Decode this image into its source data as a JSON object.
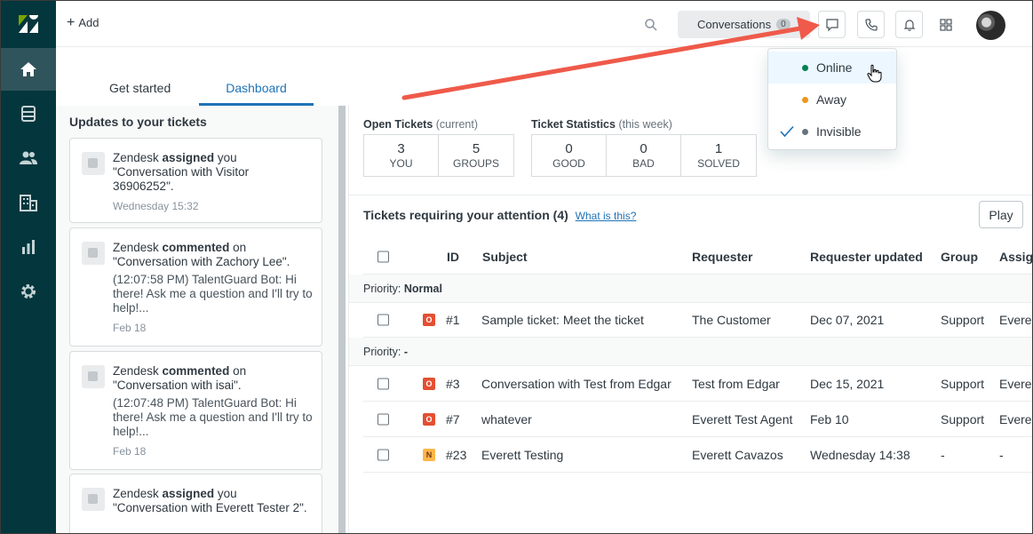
{
  "topbar": {
    "add_label": "Add",
    "conversations_label": "Conversations",
    "conversations_count": "0"
  },
  "tabs": [
    {
      "label": "Get started"
    },
    {
      "label": "Dashboard"
    }
  ],
  "updates": {
    "title": "Updates to your tickets",
    "cards": [
      {
        "actor": "Zendesk",
        "verb": "assigned",
        "rest": "you \"Conversation with Visitor 36906252\".",
        "body": "",
        "time": "Wednesday 15:32"
      },
      {
        "actor": "Zendesk",
        "verb": "commented",
        "rest": "on \"Conversation with Zachory Lee\".",
        "body": "(12:07:58 PM) TalentGuard Bot: Hi there! Ask me a question and I'll try to help!...",
        "time": "Feb 18"
      },
      {
        "actor": "Zendesk",
        "verb": "commented",
        "rest": "on \"Conversation with isai\".",
        "body": "(12:07:48 PM) TalentGuard Bot: Hi there! Ask me a question and I'll try to help!...",
        "time": "Feb 18"
      },
      {
        "actor": "Zendesk",
        "verb": "assigned",
        "rest": "you \"Conversation with Everett Tester 2\".",
        "body": "",
        "time": ""
      }
    ]
  },
  "open_tickets": {
    "label": "Open Tickets",
    "qualifier": "(current)",
    "cells": [
      {
        "num": "3",
        "label": "YOU"
      },
      {
        "num": "5",
        "label": "GROUPS"
      }
    ]
  },
  "ticket_stats": {
    "label": "Ticket Statistics",
    "qualifier": "(this week)",
    "cells": [
      {
        "num": "0",
        "label": "GOOD"
      },
      {
        "num": "0",
        "label": "BAD"
      },
      {
        "num": "1",
        "label": "SOLVED"
      }
    ]
  },
  "attention": {
    "title": "Tickets requiring your attention (4)",
    "what_link": "What is this?",
    "play_label": "Play",
    "columns": [
      "ID",
      "Subject",
      "Requester",
      "Requester updated",
      "Group",
      "Assig"
    ],
    "group_normal": {
      "prefix": "Priority:",
      "value": "Normal"
    },
    "group_dash": {
      "prefix": "Priority:",
      "value": "-"
    },
    "rows": [
      {
        "status": "O",
        "id": "#1",
        "subject": "Sample ticket: Meet the ticket",
        "requester": "The Customer",
        "updated": "Dec 07, 2021",
        "group": "Support",
        "assignee": "Everet"
      },
      {
        "status": "O",
        "id": "#3",
        "subject": "Conversation with Test from Edgar",
        "requester": "Test from Edgar",
        "updated": "Dec 15, 2021",
        "group": "Support",
        "assignee": "Everet"
      },
      {
        "status": "O",
        "id": "#7",
        "subject": "whatever",
        "requester": "Everett Test Agent",
        "updated": "Feb 10",
        "group": "Support",
        "assignee": "Everet"
      },
      {
        "status": "N",
        "id": "#23",
        "subject": "Everett Testing",
        "requester": "Everett Cavazos",
        "updated": "Wednesday 14:38",
        "group": "-",
        "assignee": "-"
      }
    ]
  },
  "status_menu": {
    "items": [
      {
        "label": "Online",
        "color": "#038153"
      },
      {
        "label": "Away",
        "color": "#ed961c"
      },
      {
        "label": "Invisible",
        "color": "#68737d"
      }
    ]
  },
  "colors": {
    "sidebar": "#03363d",
    "accent": "#1f73b7",
    "arrow": "#ef5a4a"
  }
}
